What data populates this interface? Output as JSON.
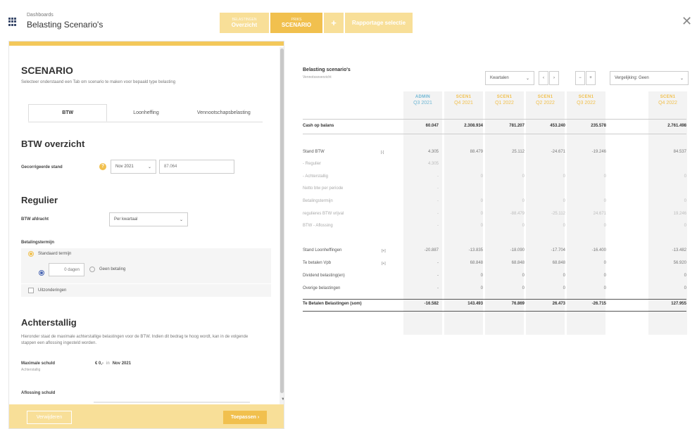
{
  "header": {
    "breadcrumb": "Dashboards",
    "title": "Belasting Scenario's",
    "tabs": [
      {
        "small": "BELASTINGEN",
        "label": "Overzicht"
      },
      {
        "small": "PRIKS",
        "label": "SCENARIO"
      },
      {
        "small": "",
        "label": "+"
      },
      {
        "small": "",
        "label": "Rapportage selectie"
      }
    ],
    "close": "✕"
  },
  "left": {
    "heading": "SCENARIO",
    "description": "Selecteer onderstaand een Tab om scenario te maken voor bepaald type belasting",
    "tabs": [
      "BTW",
      "Loonheffing",
      "Vennootschapsbelasting"
    ],
    "btw_heading": "BTW overzicht",
    "corrected_label": "Gecorrigeerde stand",
    "corrected_month": "Nov 2021",
    "corrected_value": "87.064",
    "regulier_heading": "Regulier",
    "afdracht_label": "BTW afdracht",
    "afdracht_value": "Per kwartaal",
    "termijn_label": "Betalingstermijn",
    "standard_option": "Standaard termijn",
    "days_value": "0 dagen",
    "geen_betaling": "Geen betaling",
    "exceptions": "Uitzonderingen",
    "achterstallig_heading": "Achterstallig",
    "achterstallig_desc": "Hieronder staat de maximale achterstallige belastingen voor de BTW. Indien dit bedrag te hoog wordt, kan in de volgende stappen een aflossing ingesteld worden.",
    "max_schuld_label": "Maximale schuld",
    "max_schuld_sub": "Achterstallig",
    "max_schuld_value": "€ 0,-",
    "max_schuld_in": "in",
    "max_schuld_month": "Nov 2021",
    "aflossing_label": "Aflossing schuld",
    "btn_delete": "Verwijderen",
    "btn_apply": "Toepassen ›"
  },
  "right": {
    "title": "Belasting scenario's",
    "subtitle": "Vennotssoverzicht",
    "period": "Kwartalen",
    "compare": "Vergelijking: Geen",
    "nav": [
      "‹",
      "›",
      "−",
      "+"
    ],
    "columns": [
      {
        "type": "ADMIN",
        "period": "Q3 2021",
        "color": "#6fb7d4"
      },
      {
        "type": "SCEN1",
        "period": "Q4 2021",
        "color": "#f1c04e"
      },
      {
        "type": "SCEN1",
        "period": "Q1 2022",
        "color": "#f1c04e"
      },
      {
        "type": "SCEN1",
        "period": "Q2 2022",
        "color": "#f1c04e"
      },
      {
        "type": "SCEN1",
        "period": "Q3 2022",
        "color": "#f1c04e"
      },
      {
        "type": "SCEN1",
        "period": "Q4 2022",
        "color": "#f1c04e"
      }
    ],
    "rows": [
      {
        "label": "Cash op balans",
        "style": "b",
        "expander": "",
        "values": [
          "60.047",
          "2.308.934",
          "781.207",
          "453.240",
          "235.578",
          "2.761.498"
        ]
      },
      {
        "label": "Stand BTW",
        "style": "",
        "expander": "[-]",
        "values": [
          "4.305",
          "88.479",
          "25.112",
          "-24.671",
          "-19.246",
          "84.537"
        ]
      },
      {
        "label": "- Regulier",
        "style": "m",
        "expander": "",
        "values": [
          "4.305",
          "",
          "",
          "",
          "",
          ""
        ]
      },
      {
        "label": "- Achterstallig",
        "style": "m",
        "expander": "",
        "values": [
          "-",
          "0",
          "0",
          "0",
          "0",
          "0"
        ]
      },
      {
        "label": "Netto btw per periode",
        "style": "m",
        "expander": "",
        "values": [
          "-",
          "",
          "",
          "",
          "",
          ""
        ]
      },
      {
        "label": "Betalingstermijn",
        "style": "m",
        "expander": "",
        "values": [
          "-",
          "0",
          "0",
          "0",
          "0",
          "0"
        ]
      },
      {
        "label": "regulieres BTW vrijval",
        "style": "m",
        "expander": "",
        "values": [
          "-",
          "0",
          "-88.479",
          "-25.112",
          "24.671",
          "19.246"
        ]
      },
      {
        "label": "BTW - Aflossing",
        "style": "m",
        "expander": "",
        "values": [
          "-",
          "0",
          "0",
          "0",
          "0",
          "0"
        ]
      },
      {
        "label": "Stand Loonheffingen",
        "style": "",
        "expander": "[+]",
        "values": [
          "-20.887",
          "-13.835",
          "-18.090",
          "-17.704",
          "-16.400",
          "-13.482"
        ]
      },
      {
        "label": "Te betalen Vpb",
        "style": "",
        "expander": "[+]",
        "values": [
          "-",
          "68.848",
          "68.848",
          "68.848",
          "0",
          "56.920"
        ]
      },
      {
        "label": "Dividend belasting(en)",
        "style": "",
        "expander": "",
        "values": [
          "-",
          "0",
          "0",
          "0",
          "0",
          "0"
        ]
      },
      {
        "label": "Overige belastingen",
        "style": "",
        "expander": "",
        "values": [
          "-",
          "0",
          "0",
          "0",
          "0",
          "0"
        ]
      },
      {
        "label": "Te Betalen Belastingen (som)",
        "style": "b",
        "expander": "",
        "values": [
          "-16.582",
          "143.493",
          "76.869",
          "26.473",
          "-26.715",
          "127.955"
        ]
      }
    ]
  }
}
